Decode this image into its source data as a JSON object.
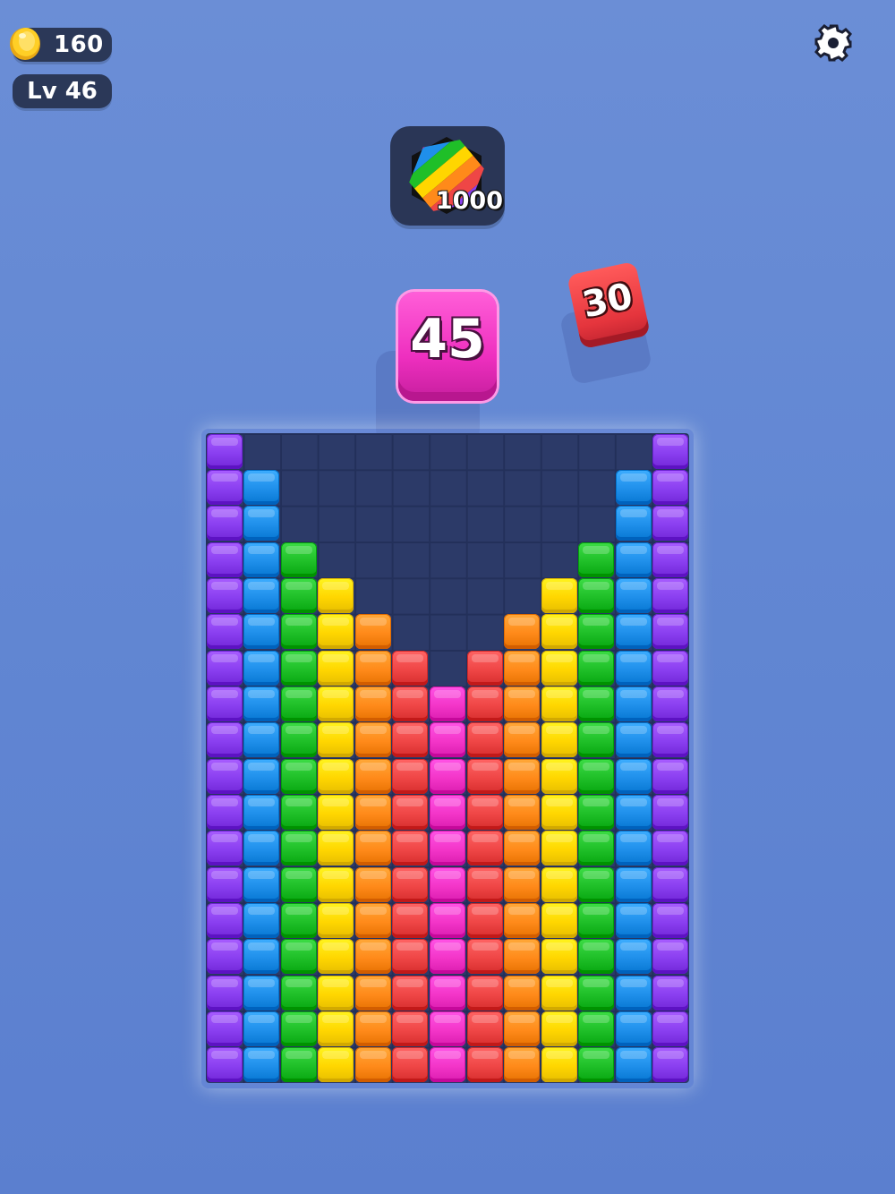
{
  "hud": {
    "coins": "160",
    "level": "Lv 46"
  },
  "goal": {
    "icon": "rainbow-hexagon-icon",
    "count": "1000"
  },
  "current_block": {
    "value": "45",
    "color": "#ee2fbf"
  },
  "next_block": {
    "value": "30",
    "color": "#e5353d"
  },
  "board": {
    "columns": 13,
    "rows": 18,
    "column_colors": [
      "#8a3ff0",
      "#1f8fea",
      "#1fbf28",
      "#ffd600",
      "#ff8a1a",
      "#ef4646",
      "#f335c8",
      "#ef4646",
      "#ff8a1a",
      "#ffd600",
      "#1fbf28",
      "#1f8fea",
      "#8a3ff0"
    ],
    "column_heights": [
      18,
      17,
      15,
      14,
      13,
      12,
      11,
      12,
      13,
      14,
      15,
      17,
      18
    ]
  }
}
